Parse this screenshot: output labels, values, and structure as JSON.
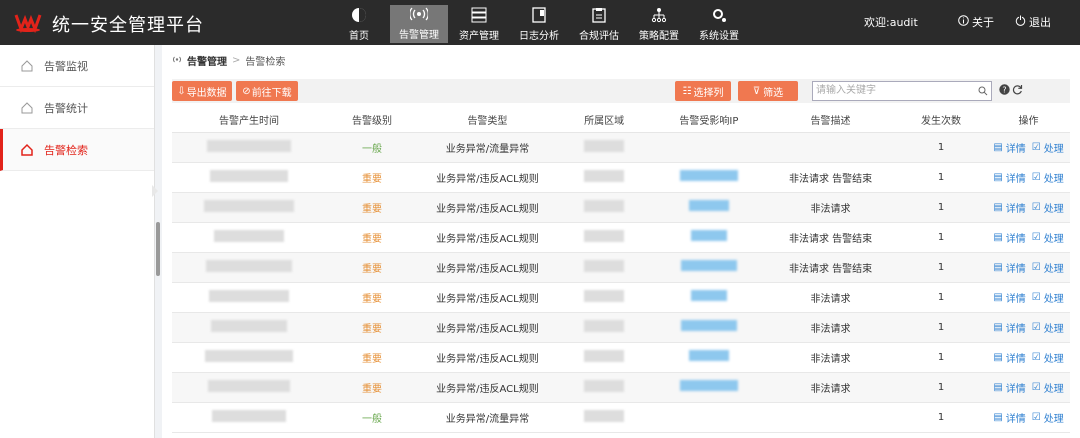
{
  "app": {
    "title": "统一安全管理平台"
  },
  "nav": [
    {
      "label": "首页",
      "icon": "home-icon"
    },
    {
      "label": "告警管理",
      "icon": "alarm-signal-icon",
      "active": true
    },
    {
      "label": "资产管理",
      "icon": "server-icon"
    },
    {
      "label": "日志分析",
      "icon": "log-icon"
    },
    {
      "label": "合规评估",
      "icon": "clipboard-icon"
    },
    {
      "label": "策略配置",
      "icon": "hierarchy-icon"
    },
    {
      "label": "系统设置",
      "icon": "settings-icon"
    }
  ],
  "header": {
    "welcome": "欢迎:audit",
    "about": "关于",
    "logout": "退出"
  },
  "sidebar": {
    "items": [
      {
        "label": "告警监视",
        "icon": "monitor-home-icon"
      },
      {
        "label": "告警统计",
        "icon": "stats-home-icon"
      },
      {
        "label": "告警检索",
        "icon": "search-home-icon",
        "active": true
      }
    ]
  },
  "breadcrumb": {
    "first": "告警管理",
    "sep": ">",
    "second": "告警检索"
  },
  "toolbar": {
    "export": "导出数据",
    "download": "前往下载",
    "select_cols": "选择列",
    "filter": "筛选",
    "search_placeholder": "请输入关键字"
  },
  "table": {
    "headers": [
      "告警产生时间",
      "告警级别",
      "告警类型",
      "所属区域",
      "告警受影响IP",
      "告警描述",
      "发生次数",
      "操作"
    ],
    "detail_label": "详情",
    "handle_label": "处理",
    "rows": [
      {
        "level": "一般",
        "type": "业务异常/流量异常",
        "desc": "",
        "count": "1"
      },
      {
        "level": "重要",
        "type": "业务异常/违反ACL规则",
        "desc": "非法请求 告警结束",
        "count": "1"
      },
      {
        "level": "重要",
        "type": "业务异常/违反ACL规则",
        "desc": "非法请求",
        "count": "1"
      },
      {
        "level": "重要",
        "type": "业务异常/违反ACL规则",
        "desc": "非法请求 告警结束",
        "count": "1"
      },
      {
        "level": "重要",
        "type": "业务异常/违反ACL规则",
        "desc": "非法请求 告警结束",
        "count": "1"
      },
      {
        "level": "重要",
        "type": "业务异常/违反ACL规则",
        "desc": "非法请求",
        "count": "1"
      },
      {
        "level": "重要",
        "type": "业务异常/违反ACL规则",
        "desc": "非法请求",
        "count": "1"
      },
      {
        "level": "重要",
        "type": "业务异常/违反ACL规则",
        "desc": "非法请求",
        "count": "1"
      },
      {
        "level": "重要",
        "type": "业务异常/违反ACL规则",
        "desc": "非法请求",
        "count": "1"
      },
      {
        "level": "一般",
        "type": "业务异常/流量异常",
        "desc": "",
        "count": "1"
      }
    ]
  },
  "colors": {
    "topbar": "#2b2b2b",
    "accent": "#e2231a",
    "button": "#f07850",
    "link": "#2f80d1",
    "level_normal": "#6aa84f",
    "level_important": "#e69138"
  }
}
